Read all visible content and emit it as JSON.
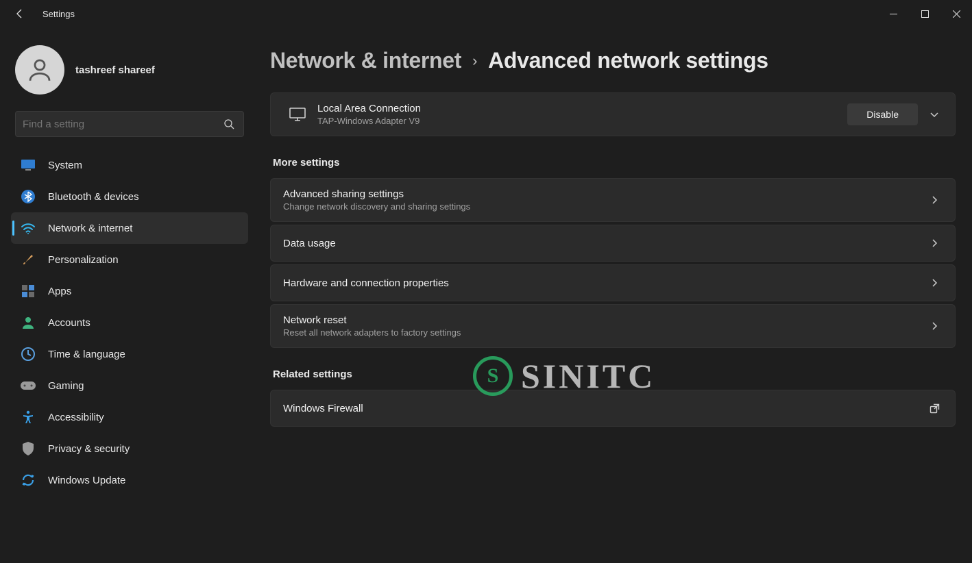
{
  "titlebar": {
    "title": "Settings"
  },
  "user": {
    "name": "tashreef shareef"
  },
  "search": {
    "placeholder": "Find a setting"
  },
  "nav": {
    "system": "System",
    "bluetooth": "Bluetooth & devices",
    "network": "Network & internet",
    "personalization": "Personalization",
    "apps": "Apps",
    "accounts": "Accounts",
    "time": "Time & language",
    "gaming": "Gaming",
    "accessibility": "Accessibility",
    "privacy": "Privacy & security",
    "update": "Windows Update"
  },
  "crumb": {
    "parent": "Network & internet",
    "current": "Advanced network settings"
  },
  "adapter": {
    "title": "Local Area Connection",
    "sub": "TAP-Windows Adapter V9",
    "button": "Disable"
  },
  "sections": {
    "more": "More settings",
    "related": "Related settings"
  },
  "more": {
    "sharing": {
      "t": "Advanced sharing settings",
      "s": "Change network discovery and sharing settings"
    },
    "data": {
      "t": "Data usage"
    },
    "hardware": {
      "t": "Hardware and connection properties"
    },
    "reset": {
      "t": "Network reset",
      "s": "Reset all network adapters to factory settings"
    }
  },
  "related": {
    "firewall": {
      "t": "Windows Firewall"
    }
  },
  "watermark": "SINITC"
}
